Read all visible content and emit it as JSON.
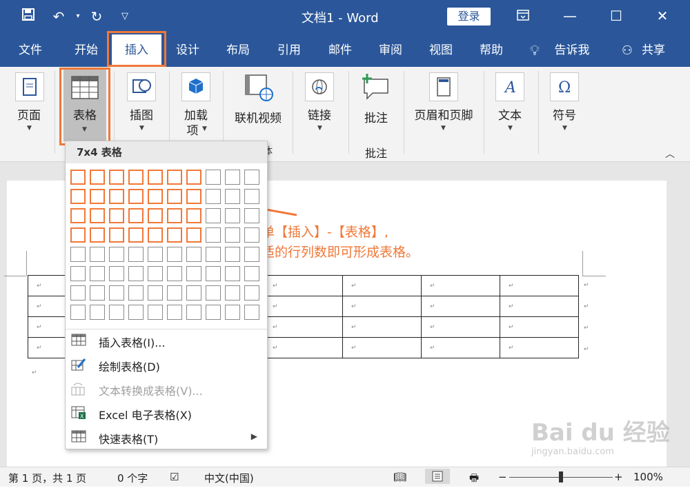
{
  "titlebar": {
    "doc_title": "文档1  -  Word",
    "login": "登录",
    "icons": [
      "save-icon",
      "undo-icon",
      "redo-icon",
      "customize-qat-icon",
      "ribbon-display-icon",
      "minimize-icon",
      "maximize-icon",
      "close-icon"
    ]
  },
  "tabs": [
    {
      "label": "文件"
    },
    {
      "label": "开始"
    },
    {
      "label": "插入"
    },
    {
      "label": "设计"
    },
    {
      "label": "布局"
    },
    {
      "label": "引用"
    },
    {
      "label": "邮件"
    },
    {
      "label": "审阅"
    },
    {
      "label": "视图"
    },
    {
      "label": "帮助"
    }
  ],
  "tell_me": "告诉我",
  "share": "共享",
  "ribbon": {
    "pages": "页面",
    "table": "表格",
    "illustrations": "插图",
    "addins_line1": "加载",
    "addins_line2": "项",
    "online_video": "联机视频",
    "link": "链接",
    "comment": "批注",
    "comment_group": "批注",
    "header_footer": "页眉和页脚",
    "text": "文本",
    "symbols": "符号",
    "media_group_partial": "体"
  },
  "dropdown": {
    "header": "7x4 表格",
    "grid_cols": 10,
    "grid_rows": 8,
    "selected_cols": 7,
    "selected_rows": 4,
    "menu": [
      {
        "label": "插入表格(I)...",
        "icon": "insert-table-icon",
        "enabled": true
      },
      {
        "label": "绘制表格(D)",
        "icon": "draw-table-icon",
        "enabled": true
      },
      {
        "label": "文本转换成表格(V)...",
        "icon": "convert-text-icon",
        "enabled": false
      },
      {
        "label": "Excel 电子表格(X)",
        "icon": "excel-icon",
        "enabled": true
      },
      {
        "label": "快速表格(T)",
        "icon": "quick-tables-icon",
        "enabled": true
      }
    ]
  },
  "annotation": {
    "line1": "点击菜单【插入】-【表格】,",
    "line2": "选择合适的行列数即可形成表格。"
  },
  "doc": {
    "cell_mark": "↵",
    "rows": 4,
    "cols": 7
  },
  "statusbar": {
    "page": "第 1 页，共 1 页",
    "words": "0 个字",
    "language": "中文(中国)",
    "zoom": "100%",
    "zoom_minus": "−",
    "zoom_plus": "+",
    "zoom_level": 1.0
  },
  "watermark": {
    "logo": "Bai du 经验",
    "url": "jingyan.baidu.com"
  }
}
